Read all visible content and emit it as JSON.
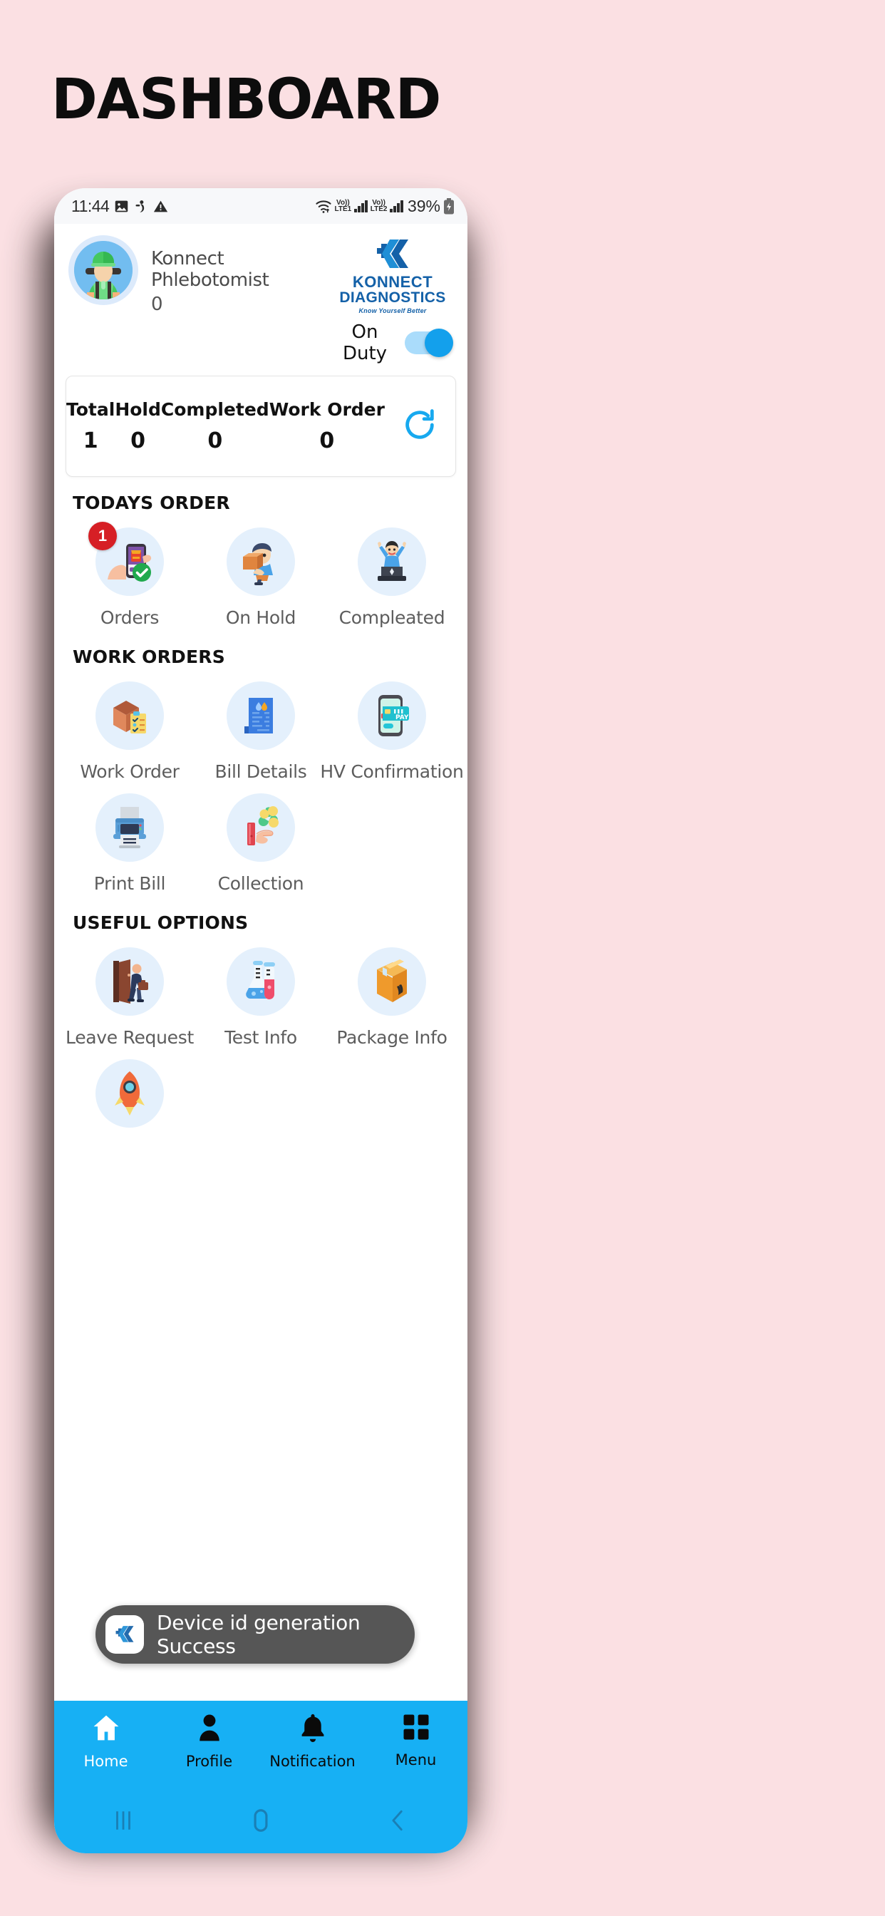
{
  "page": {
    "title": "DASHBOARD",
    "background_color": "#fbe0e3"
  },
  "statusbar": {
    "time": "11:44",
    "icons_left": [
      "image-icon",
      "person-icon",
      "warning-icon"
    ],
    "wifi": "wifi-icon",
    "sim1": {
      "volte": "Vo))",
      "network": "LTE1"
    },
    "sim2": {
      "volte": "Vo))",
      "network": "LTE2"
    },
    "battery_percent": "39%",
    "battery_state": "charging"
  },
  "header": {
    "avatar": "phlebotomist-avatar",
    "user_name": "Konnect Phlebotomist",
    "user_id": "0",
    "brand": {
      "logo": "konnect-k-logo",
      "name": "KONNECT",
      "sub": "DIAGNOSTICS",
      "tagline": "Know Yourself Better"
    },
    "duty": {
      "label": "On Duty",
      "state": "on"
    }
  },
  "stats": {
    "items": [
      {
        "label": "Total",
        "value": "1"
      },
      {
        "label": "Hold",
        "value": "0"
      },
      {
        "label": "Completed",
        "value": "0"
      },
      {
        "label": "Work Order",
        "value": "0"
      }
    ],
    "refresh_icon": "refresh-icon",
    "refresh_color": "#17a9ef"
  },
  "sections": [
    {
      "title": "TODAYS ORDER",
      "tiles": [
        {
          "label": "Orders",
          "icon": "hand-phone-order-icon",
          "badge": "1"
        },
        {
          "label": "On Hold",
          "icon": "delivery-person-box-icon",
          "badge": null
        },
        {
          "label": "Compleated",
          "icon": "person-celebrating-laptop-icon",
          "badge": null
        }
      ]
    },
    {
      "title": "WORK ORDERS",
      "tiles": [
        {
          "label": "Work Order",
          "icon": "box-checklist-icon",
          "badge": null
        },
        {
          "label": "Bill Details",
          "icon": "blue-invoice-icon",
          "badge": null
        },
        {
          "label": "HV Confirmation",
          "icon": "phone-card-pay-icon",
          "badge": null
        },
        {
          "label": "Print Bill",
          "icon": "printer-icon",
          "badge": null
        },
        {
          "label": "Collection",
          "icon": "hand-coins-icon",
          "badge": null
        }
      ]
    },
    {
      "title": "USEFUL OPTIONS",
      "tiles": [
        {
          "label": "Leave Request",
          "icon": "person-leaving-door-icon",
          "badge": null
        },
        {
          "label": "Test Info",
          "icon": "lab-flask-tube-icon",
          "badge": null
        },
        {
          "label": "Package Info",
          "icon": "orange-package-box-icon",
          "badge": null
        },
        {
          "label": "",
          "icon": "rocket-icon",
          "badge": null
        }
      ]
    }
  ],
  "toast": {
    "logo": "konnect-k-logo",
    "message": "Device id generation Success"
  },
  "bottom_nav": {
    "background_color": "#17b0f4",
    "items": [
      {
        "label": "Home",
        "icon": "home-icon",
        "active": true
      },
      {
        "label": "Profile",
        "icon": "person-icon",
        "active": false
      },
      {
        "label": "Notification",
        "icon": "bell-icon",
        "active": false
      },
      {
        "label": "Menu",
        "icon": "grid-menu-icon",
        "active": false
      }
    ]
  },
  "android_nav": {
    "recents": "recents-icon",
    "home": "home-pill-icon",
    "back": "back-chevron-icon"
  }
}
